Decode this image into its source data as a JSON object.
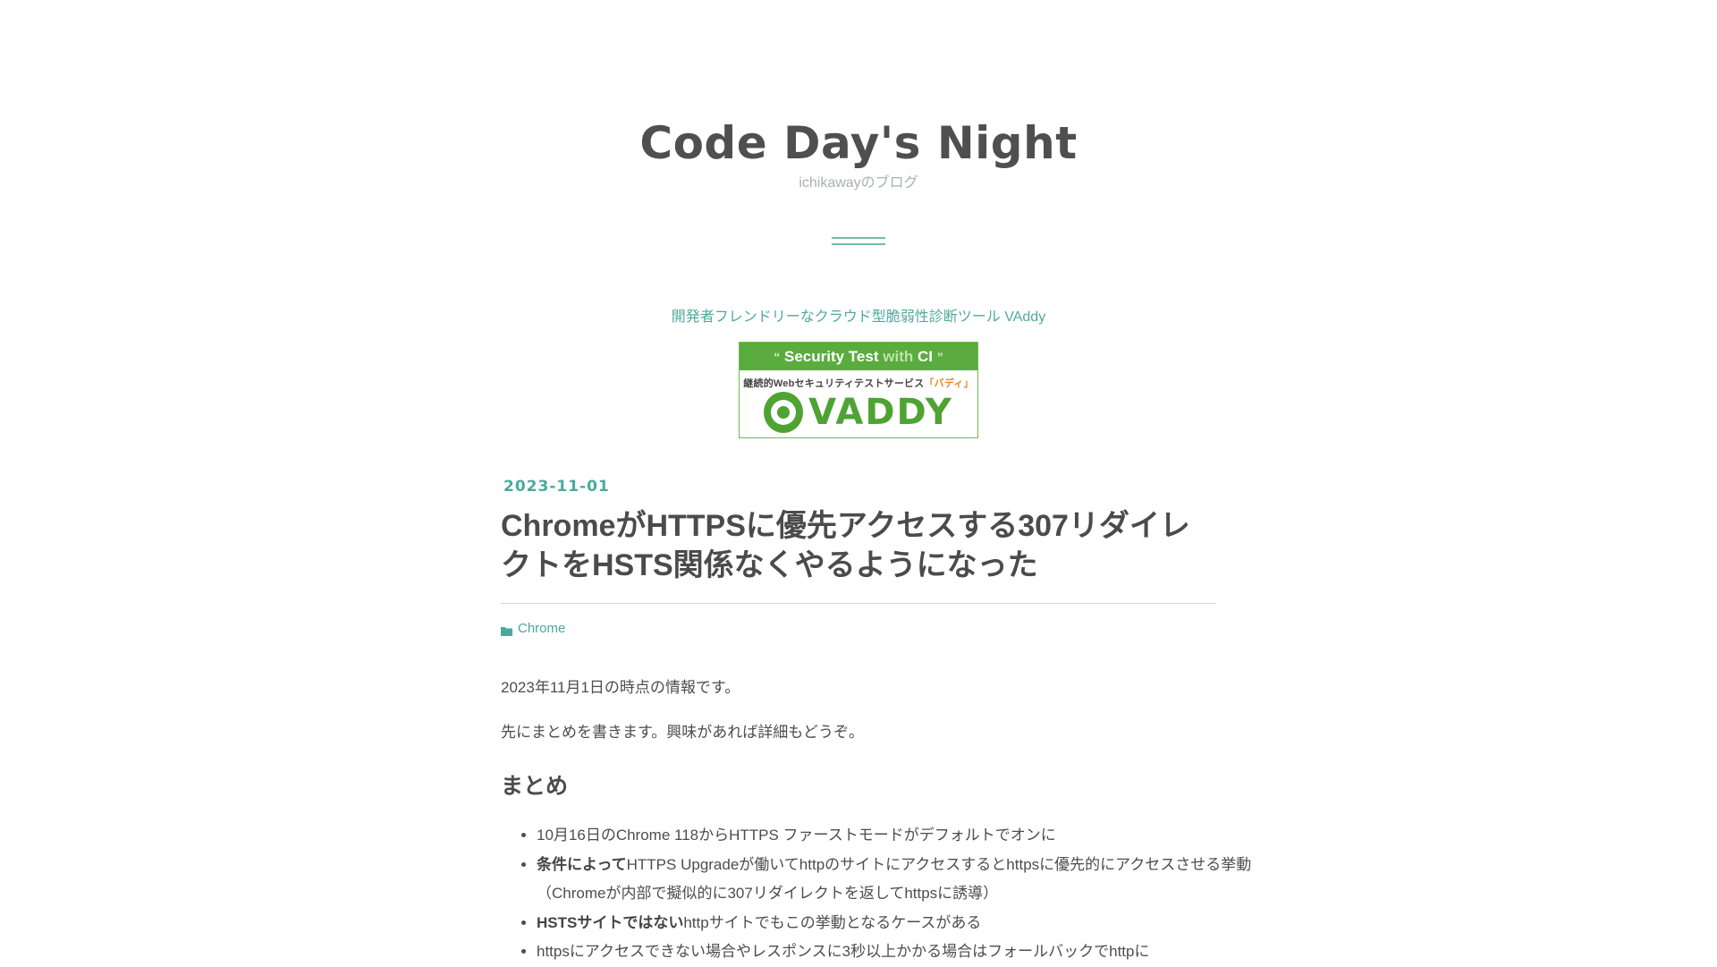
{
  "header": {
    "title": "Code Day's Night",
    "description": "ichikawayのブログ"
  },
  "ad": {
    "link_text": "開発者フレンドリーなクラウド型脆弱性診断ツール VAddy",
    "banner": {
      "quote_open": "“",
      "tagline_main": "Security Test",
      "tagline_with": "with",
      "tagline_ci": "CI",
      "quote_close": "”",
      "subtitle": "継続的Webセキュリティテストサービス",
      "subtitle_highlight": "「バディ」",
      "logo_text": "VADDY"
    }
  },
  "article": {
    "date": "2023-11-01",
    "title": "ChromeがHTTPSに優先アクセスする307リダイレクトをHSTS関係なくやるようになった",
    "category": "Chrome",
    "paragraphs": [
      "2023年11月1日の時点の情報です。",
      "先にまとめを書きます。興味があれば詳細もどうぞ。"
    ],
    "section_heading": "まとめ",
    "summary_items": [
      {
        "bold": "",
        "text": "10月16日のChrome 118からHTTPS ファーストモードがデフォルトでオンに"
      },
      {
        "bold": "条件によって",
        "text": "HTTPS Upgradeが働いてhttpのサイトにアクセスするとhttpsに優先的にアクセスさせる挙動（Chromeが内部で擬似的に307リダイレクトを返してhttpsに誘導）"
      },
      {
        "bold": "HSTSサイトではない",
        "text": "httpサイトでもこの挙動となるケースがある"
      },
      {
        "bold": "",
        "text": "httpsにアクセスできない場合やレスポンスに3秒以上かかる場合はフォールバックでhttpに"
      }
    ]
  },
  "colors": {
    "accent": "#4aa99c",
    "title_text": "#4f4f4f",
    "body_text": "#4d4d4d",
    "muted": "#aab0b4",
    "vaddy_green": "#5aac3e"
  }
}
